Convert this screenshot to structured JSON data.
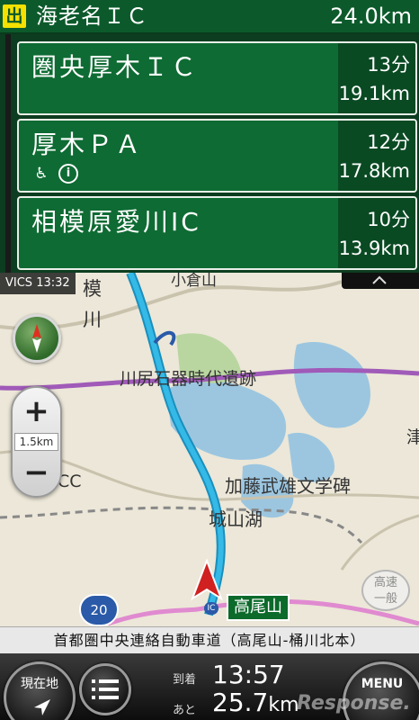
{
  "exit": {
    "badge": "出",
    "name": "海老名ＩＣ",
    "distance": "24.0km"
  },
  "highway_items": [
    {
      "name": "圏央厚木ＩＣ",
      "time": "13分",
      "distance": "19.1km",
      "icons": []
    },
    {
      "name": "厚木ＰＡ",
      "time": "12分",
      "distance": "17.8km",
      "icons": [
        "wheelchair-icon",
        "info-icon"
      ]
    },
    {
      "name": "相模原愛川IC",
      "time": "10分",
      "distance": "13.9km",
      "icons": []
    }
  ],
  "vics": "VICS 13:32",
  "map": {
    "place_sagamiko_1": "模",
    "place_sagamiko_2": "川",
    "place_oguro": "小倉山",
    "place_kawajiri": "川尻石器時代遺跡",
    "place_kato": "加藤武雄文学碑",
    "place_shiroyama": "城山湖",
    "place_cc": "CC",
    "place_chiba": "津",
    "zoom_scale": "1.5km",
    "zoom_in": "+",
    "zoom_out": "−",
    "route_number": "20",
    "ic_badge": "高尾山",
    "express_toggle_top": "高速",
    "express_toggle_bottom": "一般"
  },
  "road_name": "首都圏中央連絡自動車道（高尾山-桶川北本）",
  "bottom": {
    "current_location": "現在地",
    "menu": "MENU",
    "arrive_label": "到着",
    "arrive_time": "13:57",
    "remain_label": "あと",
    "remain_value": "25.7",
    "remain_unit": "km"
  },
  "watermark": "Response.",
  "colors": {
    "highway_green": "#0e6b33",
    "exit_yellow": "#f5e000",
    "route_cyan": "#35b9e6",
    "map_bg": "#ece7d8"
  }
}
